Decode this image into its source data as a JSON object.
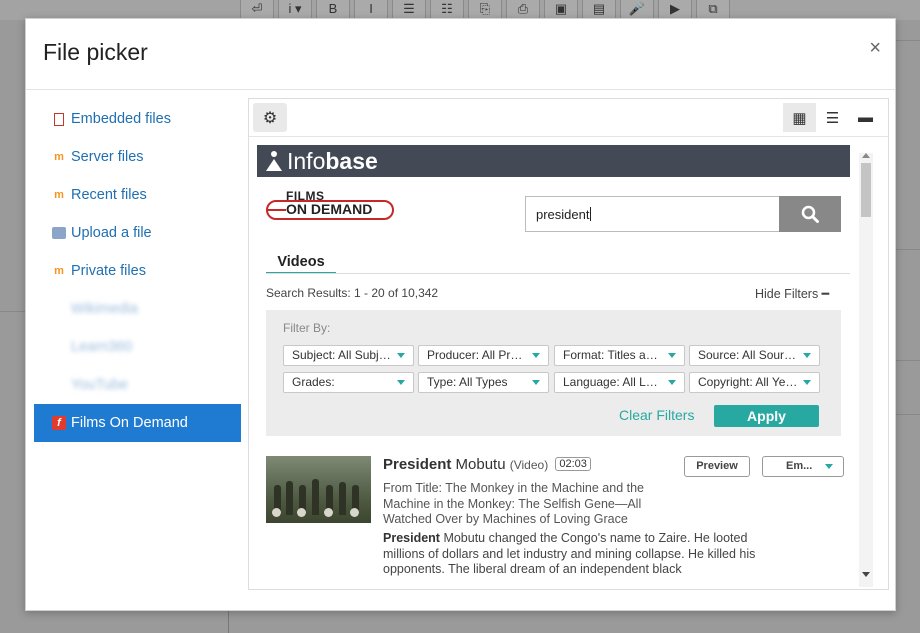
{
  "background": {
    "toolbar_glyphs": [
      "⏎",
      "i ▾",
      "B",
      "I",
      "☰",
      "☷",
      "⎘",
      "⎙",
      "▣",
      "▤",
      "🎤",
      "▶",
      "⧉"
    ]
  },
  "dialog": {
    "title": "File picker",
    "close_glyph": "×"
  },
  "sidebar": {
    "items": [
      {
        "label": "Embedded files",
        "icon": "file-icon"
      },
      {
        "label": "Server files",
        "icon": "moodle-icon"
      },
      {
        "label": "Recent files",
        "icon": "moodle-icon"
      },
      {
        "label": "Upload a file",
        "icon": "upload-icon"
      },
      {
        "label": "Private files",
        "icon": "moodle-icon"
      },
      {
        "label": "Wikimedia",
        "icon": "wikimedia-icon"
      },
      {
        "label": "Learn360",
        "icon": "learn360-icon"
      },
      {
        "label": "YouTube",
        "icon": "youtube-icon"
      },
      {
        "label": "Films On Demand",
        "icon": "films-on-demand-icon"
      }
    ],
    "active_index": 8,
    "accent_color": "#1f7ad1"
  },
  "toolbar": {
    "settings_icon": "gear-icon",
    "views": [
      "icons-view",
      "list-view",
      "tree-view"
    ]
  },
  "infobase": {
    "brand_light": "Info",
    "brand_bold": "base"
  },
  "fod": {
    "films_text": "FILMS",
    "on_demand_text": "ON DEMAND"
  },
  "search": {
    "value": "president",
    "button_icon": "search-icon"
  },
  "tabs": {
    "videos": "Videos"
  },
  "results": {
    "summary": "Search Results: 1 - 20 of 10,342",
    "hide_filters": "Hide Filters ━"
  },
  "filters": {
    "label": "Filter By:",
    "row1": [
      "Subject: All Subjects",
      "Producer: All Producers",
      "Format: Titles and Segments",
      "Source: All Sources"
    ],
    "row2": [
      "Grades:",
      "Type: All Types",
      "Language: All Languages",
      "Copyright: All Years"
    ],
    "clear": "Clear Filters",
    "apply": "Apply",
    "accent_color": "#27a9a1"
  },
  "result": {
    "title_bold": "President",
    "title_rest": " Mobutu ",
    "type": "(Video)",
    "duration": "02:03",
    "preview": "Preview",
    "embed": "Em...",
    "from_title": "From Title: The Monkey in the Machine and the Machine in the Monkey: The Selfish Gene—All Watched Over by Machines of Loving Grace",
    "desc_bold": "President",
    "desc_rest": " Mobutu changed the Congo's name to Zaire. He looted millions of dollars and let industry and mining collapse. He killed his opponents. The liberal dream of an independent black"
  }
}
